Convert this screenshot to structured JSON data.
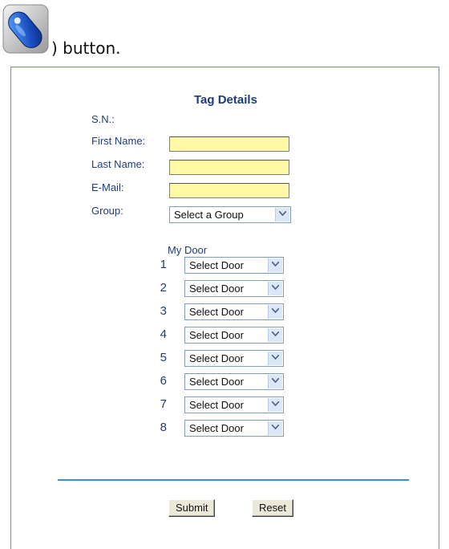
{
  "intro": {
    "icon": "blue-key-tag-icon",
    "text": ") button."
  },
  "form": {
    "title": "Tag Details",
    "fields": {
      "sn_label": "S.N.:",
      "first_name_label": "First Name:",
      "last_name_label": "Last Name:",
      "email_label": "E-Mail:",
      "group_label": "Group:",
      "first_name_value": "",
      "last_name_value": "",
      "email_value": "",
      "group_selected": "Select a Group"
    },
    "my_door": {
      "label": "My Door",
      "rows": [
        {
          "num": "1",
          "selected": "Select Door"
        },
        {
          "num": "2",
          "selected": "Select Door"
        },
        {
          "num": "3",
          "selected": "Select Door"
        },
        {
          "num": "4",
          "selected": "Select Door"
        },
        {
          "num": "5",
          "selected": "Select Door"
        },
        {
          "num": "6",
          "selected": "Select Door"
        },
        {
          "num": "7",
          "selected": "Select Door"
        },
        {
          "num": "8",
          "selected": "Select Door"
        }
      ]
    },
    "buttons": {
      "submit": "Submit",
      "reset": "Reset"
    }
  },
  "colors": {
    "label": "#1e3d7b",
    "input_bg": "#fff9a6",
    "border_accent": "#3d8fd0"
  }
}
